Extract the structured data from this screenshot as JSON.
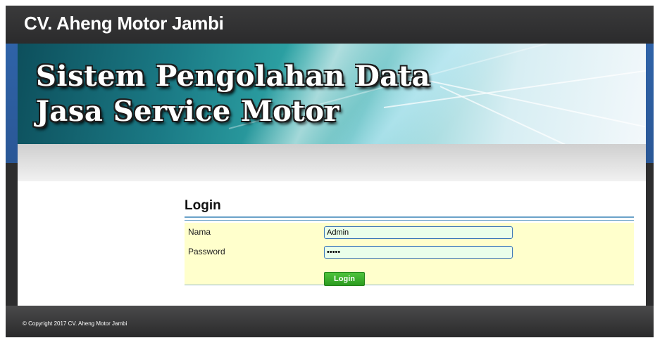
{
  "header": {
    "site_title": "CV. Aheng Motor Jambi"
  },
  "banner": {
    "line1": "Sistem Pengolahan Data",
    "line2": "Jasa Service Motor"
  },
  "login": {
    "heading": "Login",
    "nama_label": "Nama",
    "nama_value": "Admin",
    "password_label": "Password",
    "password_value": "admin",
    "button_label": "Login"
  },
  "footer": {
    "copyright": "© Copyright 2017 CV. Aheng Motor Jambi"
  },
  "colors": {
    "header_bg": "#2d2d2e",
    "band_blue": "#2f63a8",
    "panel_bg": "#ffffcc",
    "input_bg": "#eaffea",
    "button_green": "#3aa92c"
  }
}
